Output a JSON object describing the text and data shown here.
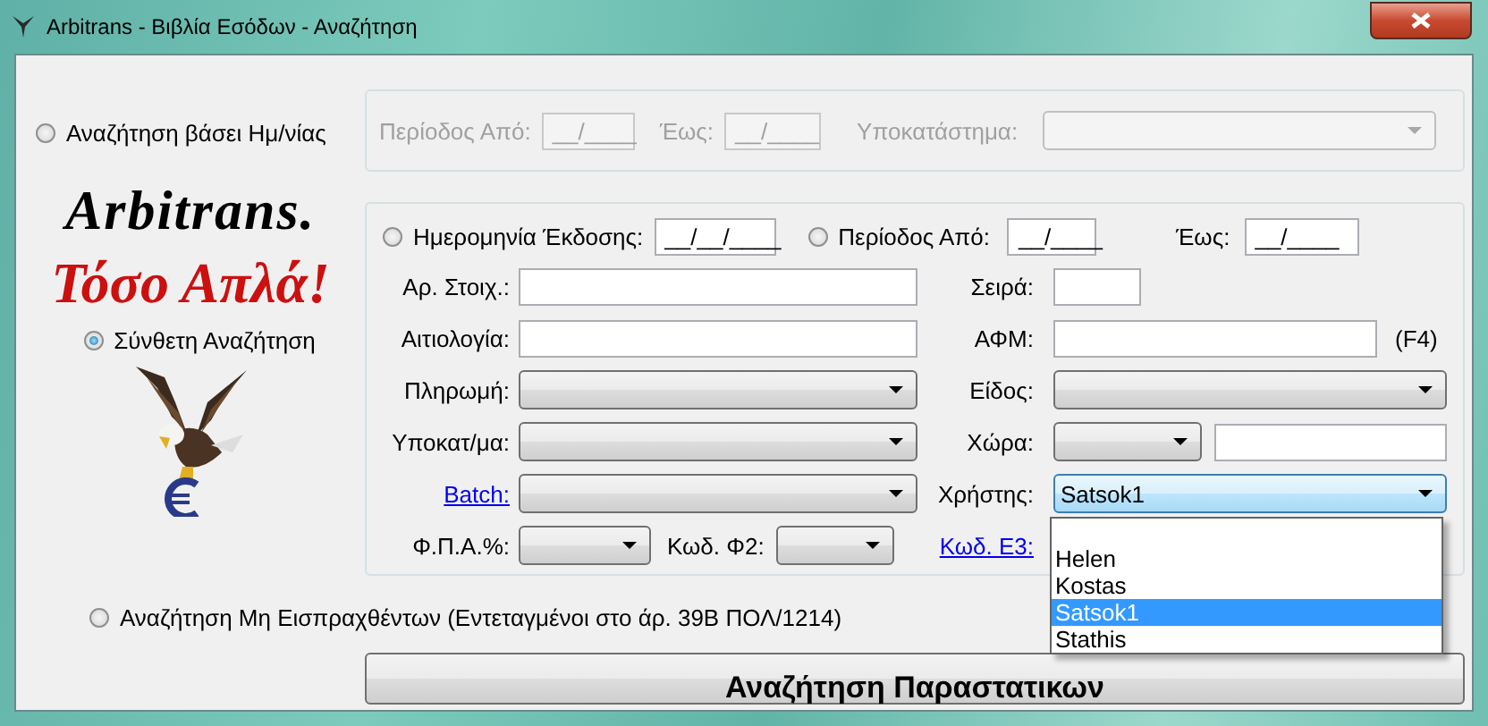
{
  "window": {
    "title": "Arbitrans - Βιβλία Εσόδων - Αναζήτηση"
  },
  "date_search": {
    "label": "Αναζήτηση βάσει Ημ/νίας",
    "selected": false,
    "disabled": true,
    "fields": [
      {
        "label": "Περίοδος Από:",
        "value": "__/____"
      },
      {
        "label": "Έως:",
        "value": "__/____"
      }
    ],
    "branch_label": "Υποκατάστημα:"
  },
  "logo": {
    "line_1": "Arbitrans.",
    "line_2": "Τόσο Απλά!"
  },
  "advanced_search": {
    "label": "Σύνθετη Αναζήτηση",
    "selected": true
  },
  "issue_date": {
    "label": "Ημερομηνία Έκδοσης:",
    "selected": false,
    "value": "__/__/____"
  },
  "period": {
    "label": "Περίοδος Από:",
    "selected": false,
    "value": "__/____",
    "to_label": "Έως:",
    "to_value": "__/____"
  },
  "rows": [
    {
      "left": {
        "label": "Αρ. Στοιχ.:",
        "kind": "text"
      },
      "right": {
        "label": "Σειρά:",
        "kind": "short_text"
      }
    },
    {
      "left": {
        "label": "Αιτιολογία:",
        "kind": "text"
      },
      "right": {
        "label": "ΑΦΜ:",
        "kind": "text",
        "note": "(F4)"
      }
    },
    {
      "left": {
        "label": "Πληρωμή:",
        "kind": "combo"
      },
      "right": {
        "label": "Είδος:",
        "kind": "combo"
      }
    },
    {
      "left": {
        "label": "Υποκατ/μα:",
        "kind": "combo"
      },
      "right": {
        "label": "Χώρα:",
        "kind": "combo_text"
      }
    },
    {
      "left": {
        "label": "Batch:",
        "kind": "link_combo"
      },
      "right": {
        "label": "Χρήστης:",
        "kind": "combo",
        "value": "Satsok1",
        "focused": true
      }
    }
  ],
  "bottom_row": {
    "vat_label": "Φ.Π.Α.%:",
    "f2_label": "Κωδ. Φ2:",
    "e3_link": "Κωδ. Ε3:"
  },
  "user_dropdown": {
    "options": [
      {
        "label": "Helen",
        "selected": false
      },
      {
        "label": "Kostas",
        "selected": false
      },
      {
        "label": "Satsok1",
        "selected": true
      },
      {
        "label": "Stathis",
        "selected": false
      }
    ]
  },
  "unpaid_search": {
    "label": "Αναζήτηση Μη Εισπραχθέντων (Εντεταγμένοι στο άρ. 39Β ΠΟΛ/1214)",
    "selected": false
  },
  "search_button": {
    "label": "Αναζήτηση Παραστατικων"
  }
}
